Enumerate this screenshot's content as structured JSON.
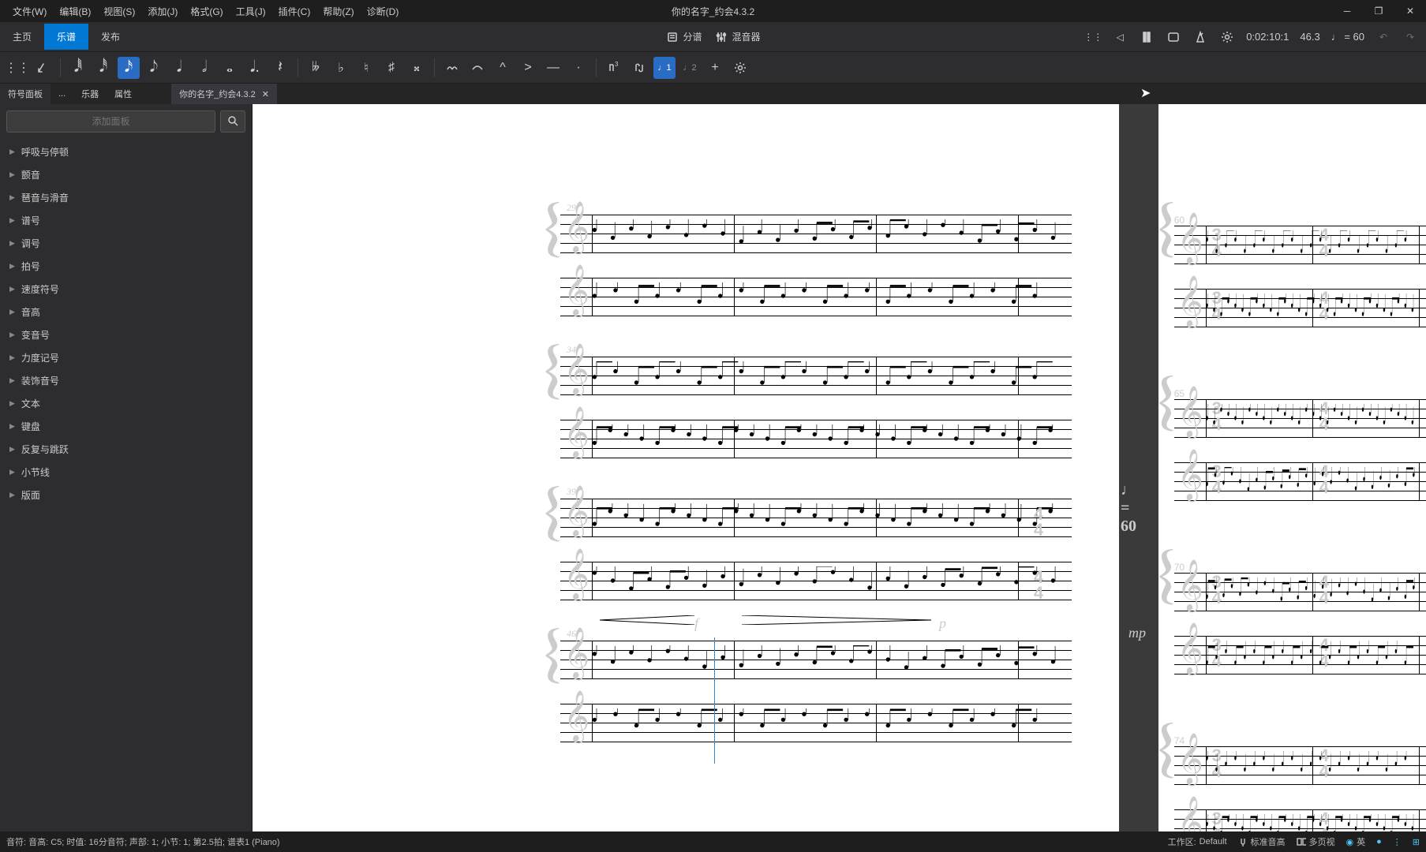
{
  "window_title": "你的名字_约会4.3.2",
  "menu": [
    "文件(W)",
    "编辑(B)",
    "视图(S)",
    "添加(J)",
    "格式(G)",
    "工具(J)",
    "插件(C)",
    "帮助(Z)",
    "诊断(D)"
  ],
  "tabs": {
    "home": "主页",
    "score": "乐谱",
    "publish": "发布"
  },
  "center_toolbar": {
    "parts": "分谱",
    "mixer": "混音器"
  },
  "playback": {
    "time": "0:02:10:1",
    "bpm_number": "46.3",
    "tempo": "♩ = 60"
  },
  "sidebar_tabs": {
    "palette": "符号面板",
    "more": "...",
    "instruments": "乐器",
    "properties": "属性"
  },
  "document_tab": "你的名字_约会4.3.2",
  "sidebar": {
    "search_placeholder": "添加面板",
    "items": [
      "呼吸与停顿",
      "颤音",
      "琶音与滑音",
      "谱号",
      "调号",
      "拍号",
      "速度符号",
      "音高",
      "变音号",
      "力度记号",
      "装饰音号",
      "文本",
      "键盘",
      "反复与跳跃",
      "小节线",
      "版面"
    ]
  },
  "score": {
    "measure_nums_left": [
      "29",
      "34",
      "39",
      "46"
    ],
    "measure_nums_right": [
      "60",
      "65",
      "70",
      "74"
    ],
    "tempo_mark": "♩ = 60",
    "dynamics": {
      "f": "f",
      "p": "p",
      "mp": "mp"
    },
    "timesig_44_top": "4",
    "timesig_44_bot": "4",
    "timesig_34_top": "3",
    "timesig_34_bot": "4"
  },
  "status": {
    "selection": "音符: 音高: C5; 时值: 16分音符; 声部: 1; 小节: 1; 第2.5拍; 谱表1 (Piano)",
    "workspace_label": "工作区:",
    "workspace_value": "Default",
    "pitch_std": "标准音高",
    "multipage": "多页视",
    "ime": "英"
  }
}
